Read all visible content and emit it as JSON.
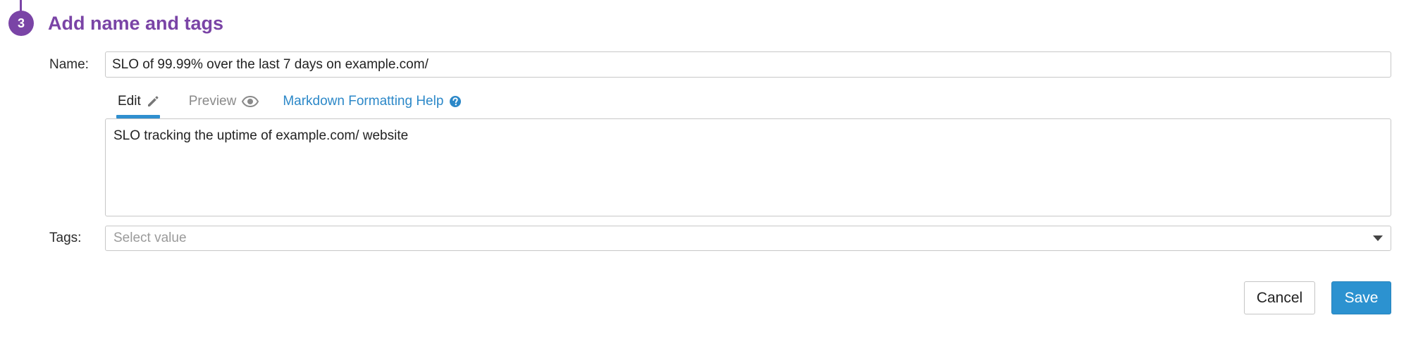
{
  "step": {
    "number": "3",
    "title": "Add name and tags"
  },
  "name_field": {
    "label": "Name:",
    "value": "SLO of 99.99% over the last 7 days on example.com/"
  },
  "description": {
    "tabs": {
      "edit": "Edit",
      "preview": "Preview",
      "help": "Markdown Formatting Help"
    },
    "active_tab": "Edit",
    "value": "SLO tracking the uptime of example.com/ website"
  },
  "tags_field": {
    "label": "Tags:",
    "placeholder": "Select value"
  },
  "actions": {
    "cancel": "Cancel",
    "save": "Save"
  },
  "colors": {
    "step_accent": "#7a44a6",
    "link": "#2c88c8",
    "primary_button": "#2c92d0",
    "active_tab_underline": "#2f8fcf"
  },
  "icons": {
    "edit_tab": "pencil-icon",
    "preview_tab": "eye-icon",
    "help_tab": "question-circle-icon",
    "tags_select": "caret-down-icon"
  }
}
